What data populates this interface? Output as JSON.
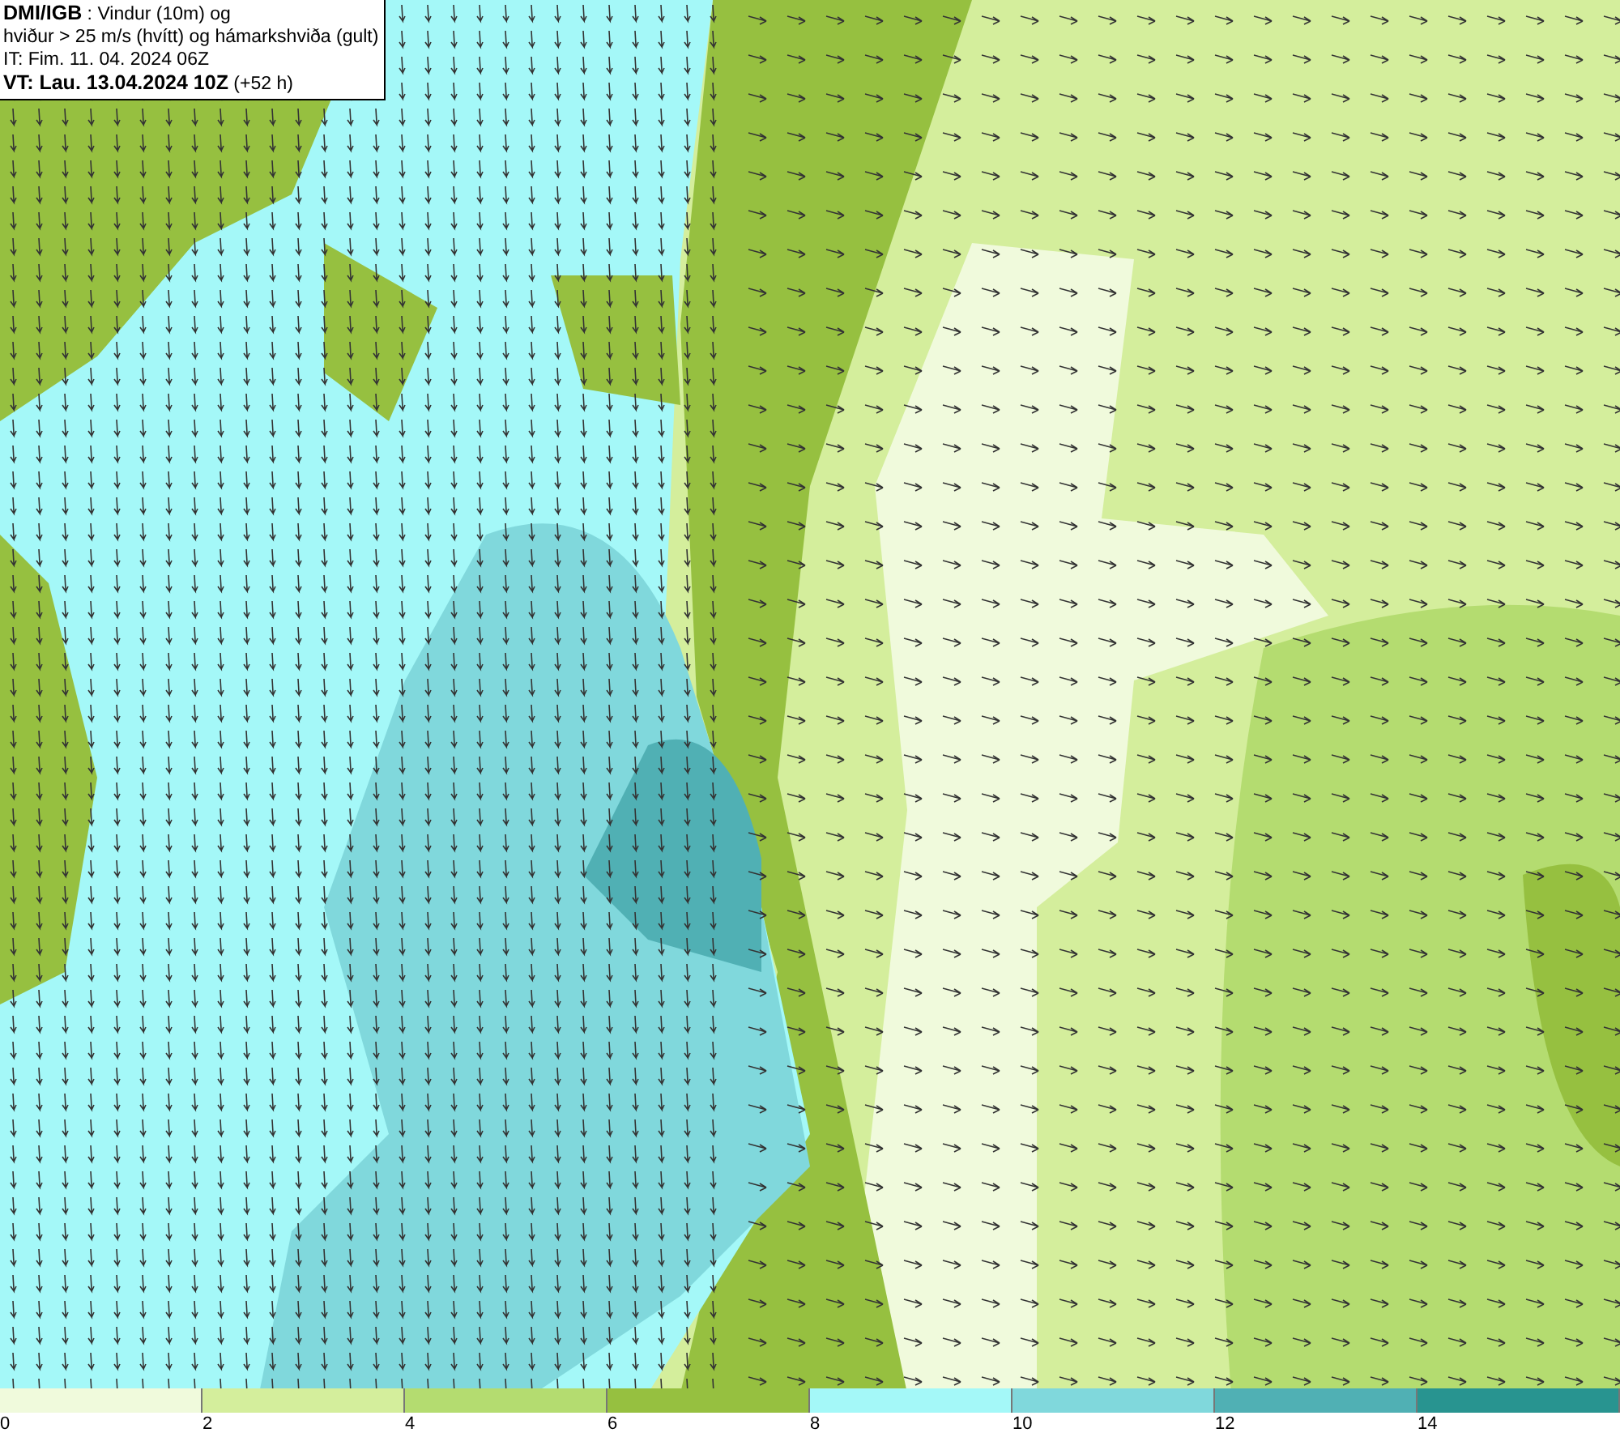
{
  "title_box": {
    "lines": [
      "**DMI/IGB** : Vindur (10m) og",
      "hviður > 25 m/s (hvítt) og hámarkshviða (gult)",
      "IT: Fim. 11. 04. 2024 06Z",
      "**VT: Lau. 13.04.2024 10Z** (+52 h)"
    ]
  },
  "legend": {
    "items": [
      {
        "label": "0",
        "color": "#f0fadc"
      },
      {
        "label": "2",
        "color": "#d4ee9c"
      },
      {
        "label": "4",
        "color": "#b4dc70"
      },
      {
        "label": "6",
        "color": "#96c040"
      },
      {
        "label": "8",
        "color": "#a4f8f8"
      },
      {
        "label": "10",
        "color": "#80d8dc"
      },
      {
        "label": "12",
        "color": "#50b0b4"
      },
      {
        "label": "14",
        "color": "#289490"
      }
    ]
  }
}
